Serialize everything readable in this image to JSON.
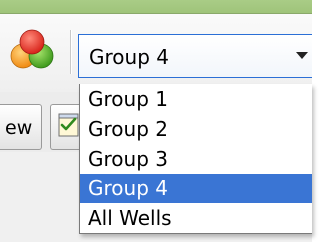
{
  "toolbar": {
    "groups_icon": "groups-icon",
    "group_combo": {
      "value": "Group 4"
    },
    "view_button_label": "ew",
    "check_button_icon": "checklist-icon"
  },
  "dropdown": {
    "options": [
      "Group 1",
      "Group 2",
      "Group 3",
      "Group 4",
      "All Wells"
    ],
    "selected_index": 3
  },
  "colors": {
    "selection": "#3a75d4",
    "top_strip": "#9fc47a",
    "focus_border": "#2b6fd6"
  }
}
